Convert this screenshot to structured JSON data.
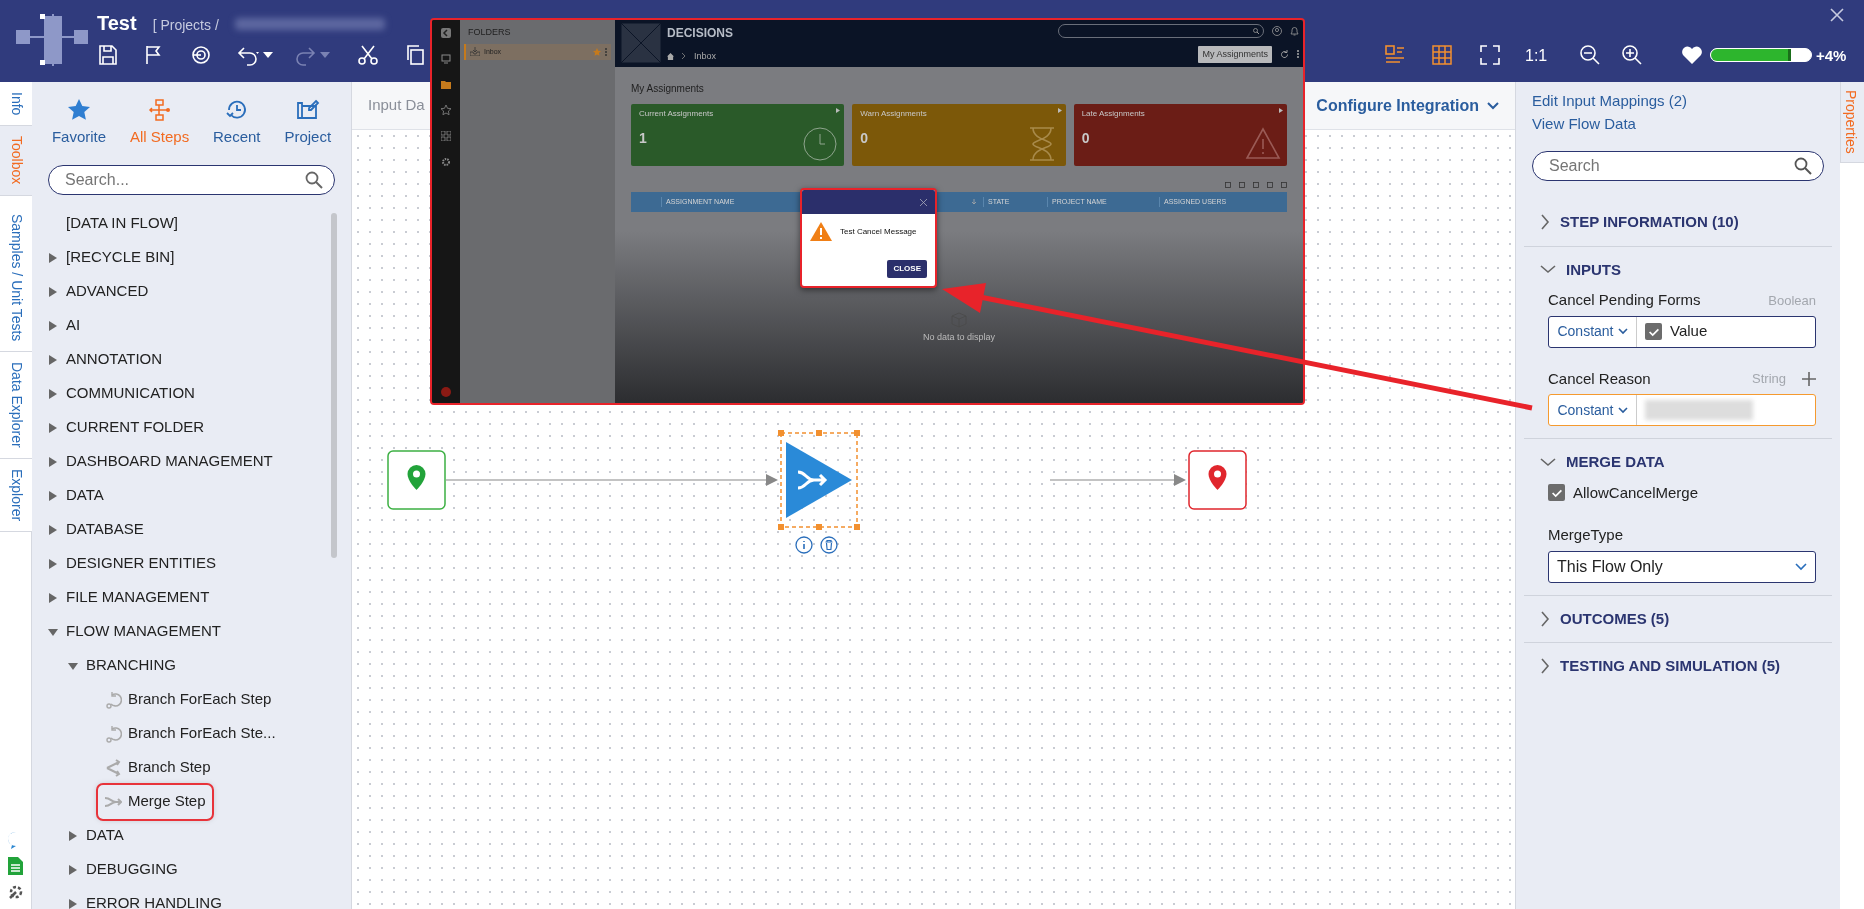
{
  "header": {
    "title": "Test",
    "breadcrumb": "[ Projects /",
    "zoom_label": "1:1",
    "health": {
      "level": 0.8,
      "reading": "+4%"
    }
  },
  "side_tabs": [
    {
      "label": "Info",
      "selected": false
    },
    {
      "label": "Toolbox",
      "selected": true
    },
    {
      "label": "Samples / Unit Tests",
      "selected": false
    },
    {
      "label": "Data Explorer",
      "selected": false
    },
    {
      "label": "Explorer",
      "selected": false
    }
  ],
  "toolbox": {
    "tabs": [
      {
        "label": "Favorite",
        "selected": false
      },
      {
        "label": "All Steps",
        "selected": true
      },
      {
        "label": "Recent",
        "selected": false
      },
      {
        "label": "Project",
        "selected": false
      }
    ],
    "search": {
      "placeholder": "Search..."
    },
    "tree": [
      {
        "label": "[DATA IN FLOW]",
        "kind": "plain"
      },
      {
        "label": "[RECYCLE BIN]",
        "kind": "category",
        "expanded": false
      },
      {
        "label": "ADVANCED",
        "kind": "category",
        "expanded": false
      },
      {
        "label": "AI",
        "kind": "category",
        "expanded": false
      },
      {
        "label": "ANNOTATION",
        "kind": "category",
        "expanded": false
      },
      {
        "label": "COMMUNICATION",
        "kind": "category",
        "expanded": false
      },
      {
        "label": "CURRENT FOLDER",
        "kind": "category",
        "expanded": false
      },
      {
        "label": "DASHBOARD MANAGEMENT",
        "kind": "category",
        "expanded": false
      },
      {
        "label": "DATA",
        "kind": "category",
        "expanded": false
      },
      {
        "label": "DATABASE",
        "kind": "category",
        "expanded": false
      },
      {
        "label": "DESIGNER ENTITIES",
        "kind": "category",
        "expanded": false
      },
      {
        "label": "FILE MANAGEMENT",
        "kind": "category",
        "expanded": false
      },
      {
        "label": "FLOW MANAGEMENT",
        "kind": "category",
        "expanded": true,
        "children": [
          {
            "label": "BRANCHING",
            "kind": "category",
            "expanded": true,
            "children": [
              {
                "label": "Branch ForEach Step",
                "kind": "step",
                "highlighted": false
              },
              {
                "label": "Branch ForEach Ste...",
                "kind": "step",
                "highlighted": false
              },
              {
                "label": "Branch Step",
                "kind": "step",
                "highlighted": false
              },
              {
                "label": "Merge Step",
                "kind": "step",
                "highlighted": true
              }
            ]
          },
          {
            "label": "DATA",
            "kind": "category",
            "expanded": false
          },
          {
            "label": "DEBUGGING",
            "kind": "category",
            "expanded": false
          },
          {
            "label": "ERROR HANDLING",
            "kind": "category",
            "expanded": false
          }
        ]
      }
    ]
  },
  "canvas": {
    "tabs": [
      "Input Da",
      "Configure Integration"
    ]
  },
  "properties_tab": {
    "label": "Properties",
    "selected": true
  },
  "inset": {
    "folders_title": "FOLDERS",
    "folder": {
      "label": "Inbox",
      "favorite": true
    },
    "brand": "DECISIONS",
    "breadcrumb": "Inbox",
    "view_button": "My Assignments",
    "heading": "My Assignments",
    "cards": [
      {
        "label": "Current Assignments",
        "count": "1",
        "color": "#2a5a29"
      },
      {
        "label": "Warn Assignments",
        "count": "0",
        "color": "#7c5809"
      },
      {
        "label": "Late Assignments",
        "count": "0",
        "color": "#6b1d16"
      }
    ],
    "columns": [
      "ASSIGNMENT NAME",
      "STATE",
      "PROJECT NAME",
      "ASSIGNED USERS"
    ],
    "empty": "No data to display",
    "dialog": {
      "message": "Test Cancel Message",
      "button": "CLOSE"
    }
  },
  "properties": {
    "links": [
      "Edit Input Mappings (2)",
      "View Flow Data"
    ],
    "search": {
      "placeholder": "Search"
    },
    "sections": [
      {
        "title": "STEP INFORMATION (10)",
        "kind": "plain",
        "expanded": false
      },
      {
        "title": "INPUTS",
        "kind": "inputs",
        "expanded": true,
        "fields": [
          {
            "label": "Cancel Pending Forms",
            "type": "Boolean",
            "mode": "Constant",
            "kind": "checkbox",
            "checked": true,
            "value_label": "Value",
            "focused": false
          },
          {
            "label": "Cancel Reason",
            "type": "String",
            "mode": "Constant",
            "kind": "text",
            "focused": true
          }
        ]
      },
      {
        "title": "MERGE DATA",
        "kind": "merge",
        "expanded": true,
        "checkbox": {
          "label": "AllowCancelMerge",
          "checked": true
        },
        "select": {
          "label": "MergeType",
          "value": "This Flow Only"
        }
      },
      {
        "title": "OUTCOMES (5)",
        "kind": "plain",
        "expanded": false
      },
      {
        "title": "TESTING AND SIMULATION (5)",
        "kind": "plain",
        "expanded": false
      }
    ]
  }
}
